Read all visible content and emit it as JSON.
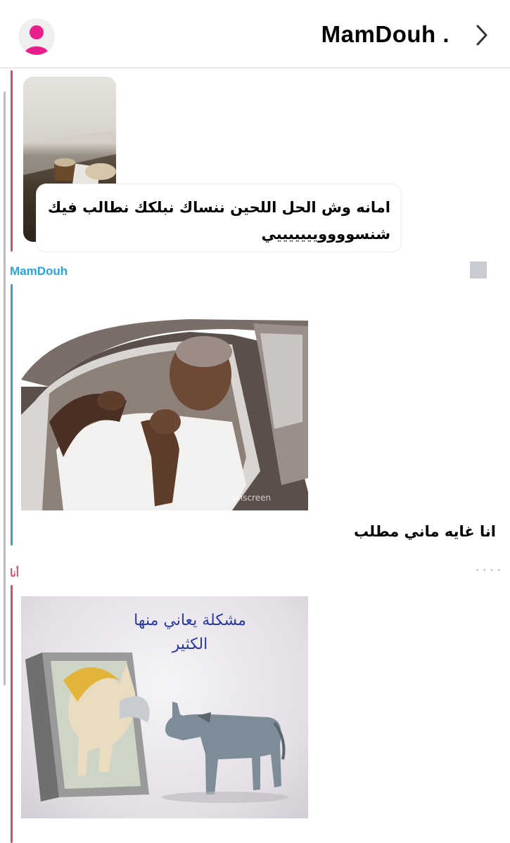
{
  "header": {
    "title": "MamDouh .",
    "avatar_icon": "user-avatar-icon",
    "back_icon": "chevron-right-icon"
  },
  "colors": {
    "my_color": "#e4475e",
    "friend_color": "#2ba3dc",
    "avatar_color": "#e91e8c"
  },
  "messages": {
    "quoted": {
      "text_line1": "امانه وش الحل اللحين ننساك نبلكك نطالب فيك",
      "text_line2": "شنسوووويييييييي"
    },
    "friend": {
      "sender": "MamDouh",
      "text": "انا غايه ماني مطلب"
    },
    "me": {
      "sender": "أنا",
      "meme_caption_line1": "مشكلة يعاني منها",
      "meme_caption_line2": "الكثير"
    }
  }
}
